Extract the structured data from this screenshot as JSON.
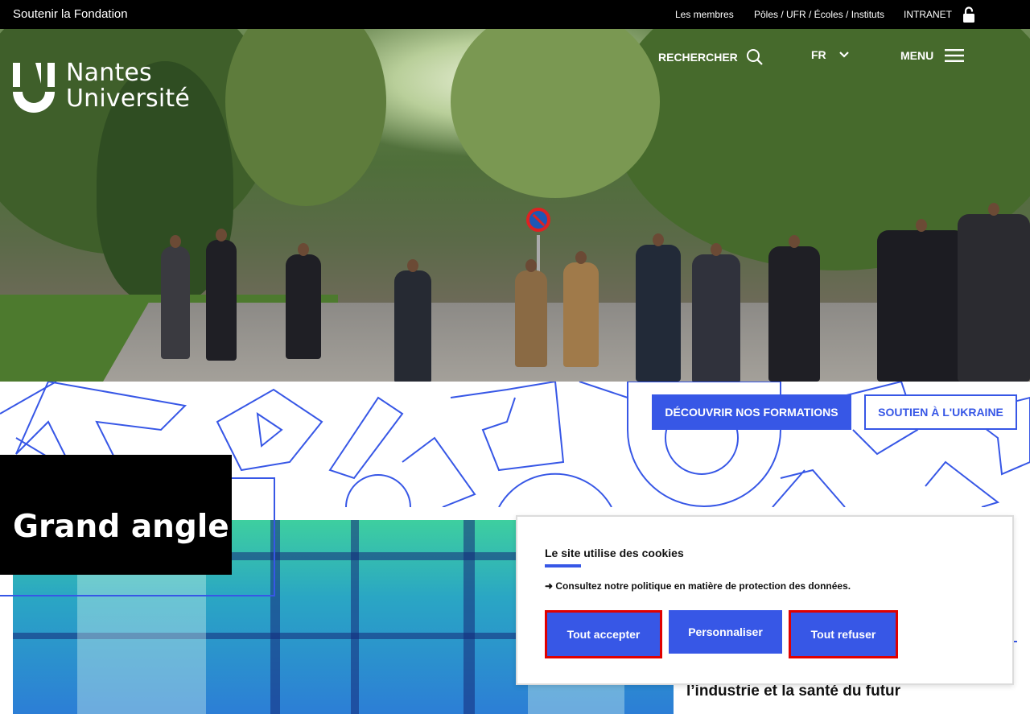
{
  "topbar": {
    "fondation": "Soutenir la Fondation",
    "links": [
      "Les membres",
      "Pôles / UFR / Écoles / Instituts",
      "INTRANET"
    ],
    "lock_icon": "lock-icon"
  },
  "logo": {
    "line1": "Nantes",
    "line2": "Université"
  },
  "header_nav": {
    "search": "RECHERCHER",
    "language": "FR",
    "menu": "MENU"
  },
  "hero_buttons": {
    "formations": "DÉCOUVRIR NOS FORMATIONS",
    "ukraine": "SOUTIEN À L'UKRAINE"
  },
  "grand_angle": {
    "title": "Grand angle",
    "feature_text": "l’industrie et la santé du futur"
  },
  "cookie": {
    "title": "Le site utilise des cookies",
    "policy": "➜ Consultez notre politique en matière de protection des données.",
    "accept": "Tout accepter",
    "customize": "Personnaliser",
    "refuse": "Tout refuser"
  },
  "colors": {
    "accent": "#3757e6",
    "topbar": "#000000",
    "highlight": "#e00000"
  }
}
